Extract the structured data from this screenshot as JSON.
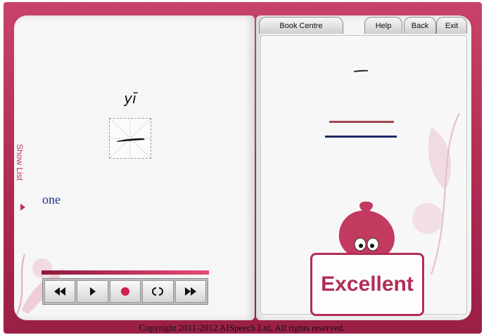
{
  "toolbar": {
    "tabs": [
      "Book Centre",
      "Help",
      "Back",
      "Exit"
    ]
  },
  "lesson": {
    "pinyin": "yī",
    "character": "一",
    "meaning": "one",
    "show_list_label": "Show List"
  },
  "controls": {
    "icons": [
      "rewind-icon",
      "play-icon",
      "record-icon",
      "loop-icon",
      "fast-forward-icon"
    ]
  },
  "feedback": {
    "result": "Excellent"
  },
  "footer": {
    "copyright": "Copyright 2011-2012 AISpeech Ltd, All rights reserved."
  },
  "colors": {
    "frame": "#b02a52",
    "accent": "#c0325a",
    "meaning_text": "#1f2e8a",
    "record_dot": "#d1204a"
  }
}
